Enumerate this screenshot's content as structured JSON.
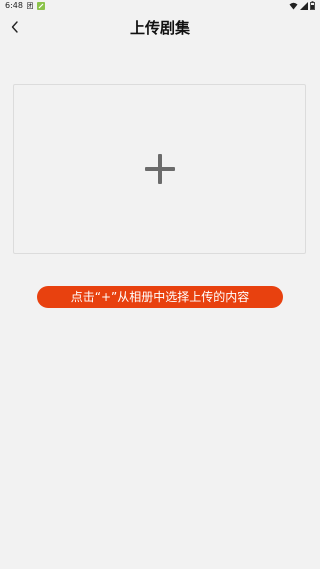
{
  "status_bar": {
    "time": "6:48",
    "notif_glyph": "团"
  },
  "header": {
    "title": "上传剧集"
  },
  "upload": {
    "plus_glyph_name": "plus-icon"
  },
  "hint": {
    "text": "点击“+”从相册中选择上传的内容"
  },
  "colors": {
    "background": "#f2f2f2",
    "accent": "#e8410f",
    "plus": "#6b6b6b"
  }
}
